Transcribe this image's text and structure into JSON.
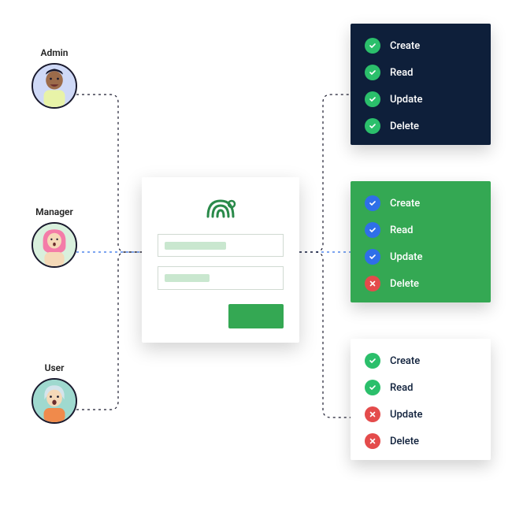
{
  "roles": [
    {
      "id": "admin",
      "label": "Admin"
    },
    {
      "id": "manager",
      "label": "Manager"
    },
    {
      "id": "user",
      "label": "User"
    }
  ],
  "permissions": {
    "admin": {
      "items": [
        {
          "label": "Create",
          "allowed": true
        },
        {
          "label": "Read",
          "allowed": true
        },
        {
          "label": "Update",
          "allowed": true
        },
        {
          "label": "Delete",
          "allowed": true
        }
      ]
    },
    "manager": {
      "items": [
        {
          "label": "Create",
          "allowed": true
        },
        {
          "label": "Read",
          "allowed": true
        },
        {
          "label": "Update",
          "allowed": true
        },
        {
          "label": "Delete",
          "allowed": false
        }
      ]
    },
    "user": {
      "items": [
        {
          "label": "Create",
          "allowed": true
        },
        {
          "label": "Read",
          "allowed": true
        },
        {
          "label": "Update",
          "allowed": false
        },
        {
          "label": "Delete",
          "allowed": false
        }
      ]
    }
  },
  "colors": {
    "green": "#34a853",
    "dark": "#0e1f3a",
    "blue": "#2f6fe8",
    "red": "#e44b4b",
    "checkGreen": "#2bbf6b"
  }
}
